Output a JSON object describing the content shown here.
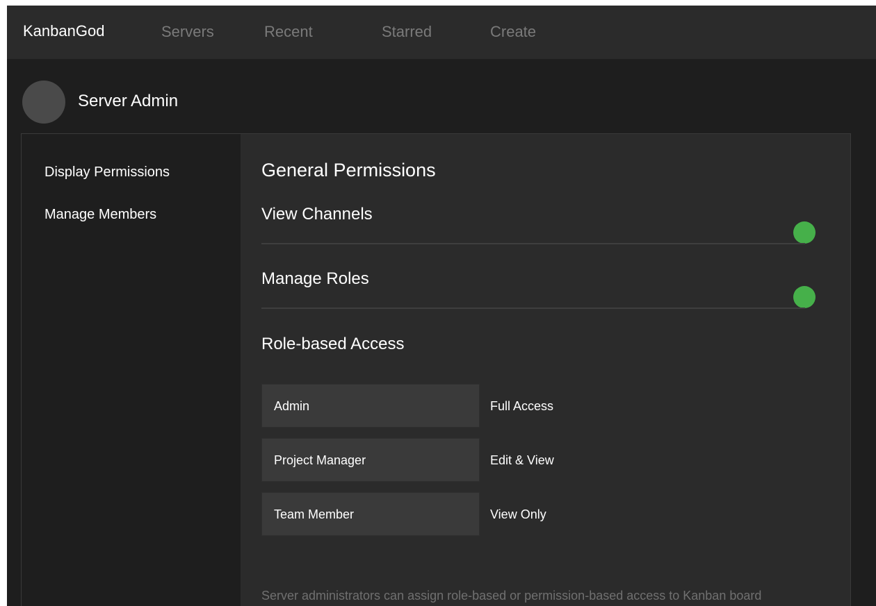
{
  "header": {
    "brand": "KanbanGod",
    "nav": [
      "Servers",
      "Recent",
      "Starred",
      "Create"
    ]
  },
  "profile": {
    "name": "Server Admin"
  },
  "sidebar": {
    "items": [
      {
        "label": "Display Permissions"
      },
      {
        "label": "Manage Members"
      }
    ]
  },
  "main": {
    "heading": "General Permissions",
    "permissions": [
      {
        "label": "View Channels",
        "enabled": true
      },
      {
        "label": "Manage Roles",
        "enabled": true
      }
    ],
    "role_section_title": "Role-based Access",
    "roles": [
      {
        "name": "Admin",
        "access": "Full Access"
      },
      {
        "name": "Project Manager",
        "access": "Edit & View"
      },
      {
        "name": "Team Member",
        "access": "View Only"
      }
    ],
    "footnote": "Server administrators can assign role-based or permission-based access to Kanban board"
  },
  "colors": {
    "toggle_on": "#46b04a",
    "background": "#1e1e1e",
    "panel": "#2b2b2b"
  }
}
